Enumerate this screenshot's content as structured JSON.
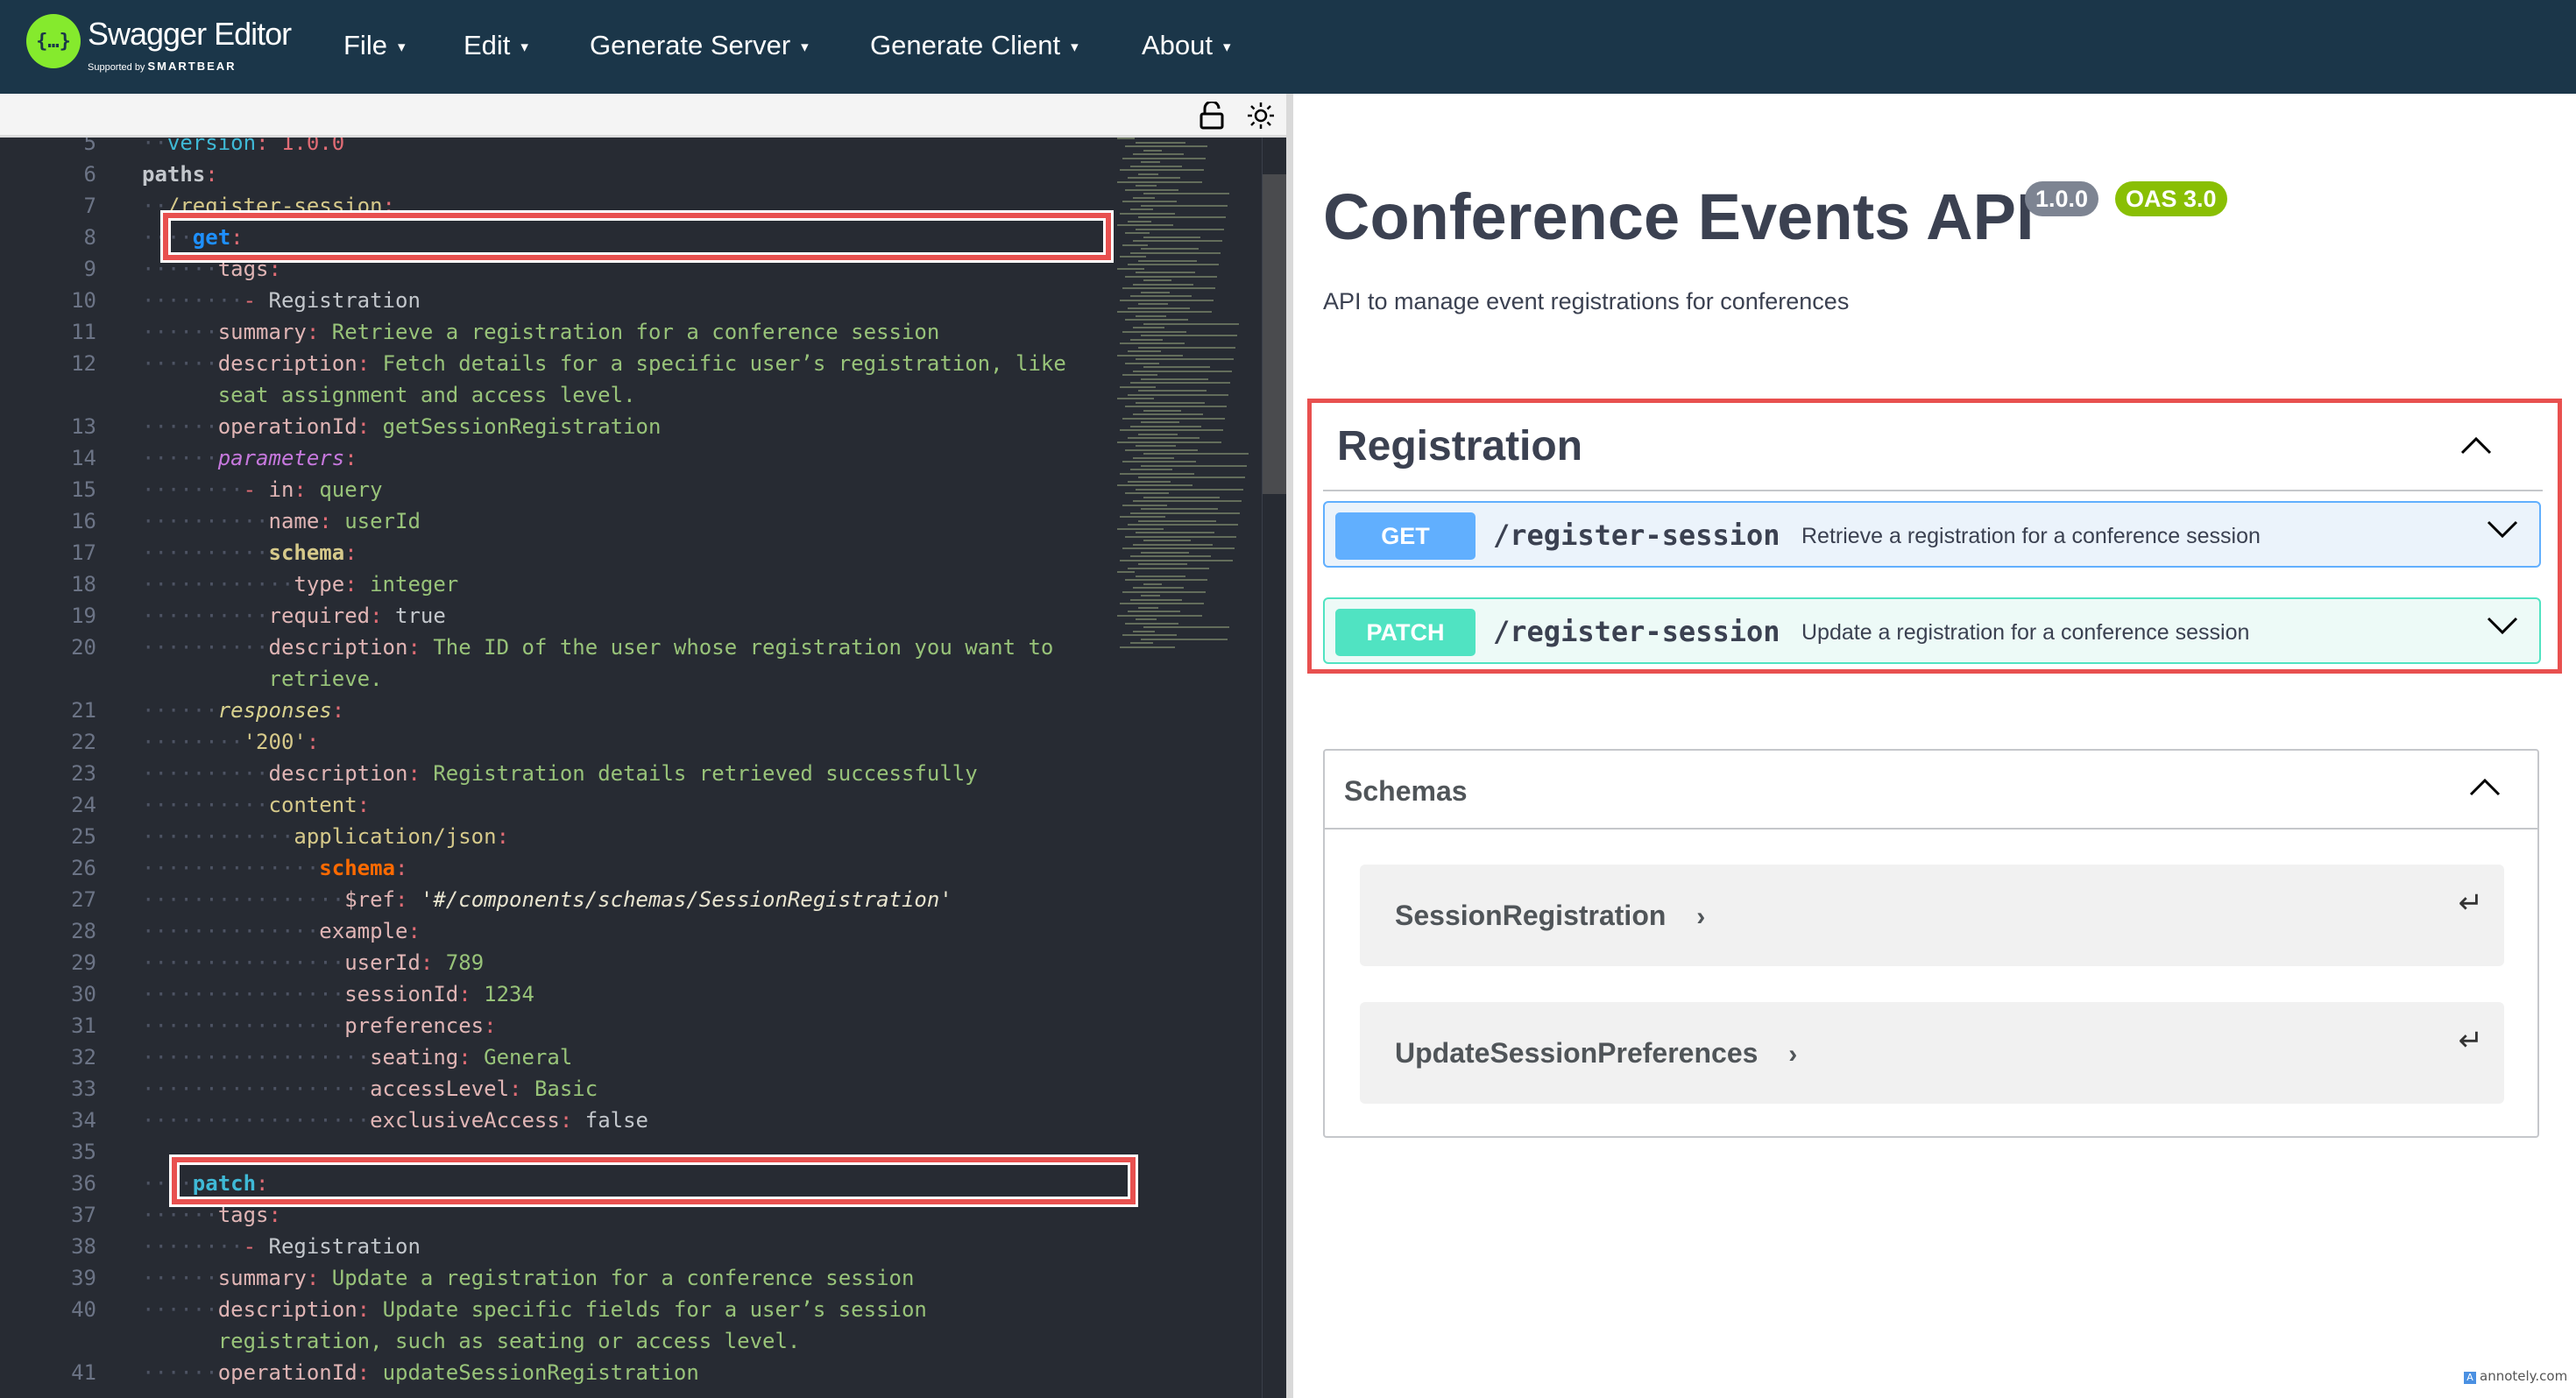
{
  "header": {
    "logo_glyph": "{…}",
    "app_name": "Swagger Editor",
    "supported_by": "Supported by",
    "brand": "SMARTBEAR",
    "nav": [
      {
        "label": "File"
      },
      {
        "label": "Edit"
      },
      {
        "label": "Generate Server"
      },
      {
        "label": "Generate Client"
      },
      {
        "label": "About"
      }
    ],
    "caret": "▾"
  },
  "toolbar": {
    "icons": [
      "unlock-icon",
      "theme-toggle-sun-icon"
    ]
  },
  "editor": {
    "lines": [
      {
        "n": "5",
        "indent": "··",
        "html": "<span class='cyan'>version</span><span class='p'>:</span> <span class='p'>1.0.0</span>"
      },
      {
        "n": "6",
        "indent": "",
        "html": "<span class='k2'>paths</span><span class='p'>:</span>"
      },
      {
        "n": "7",
        "indent": "··",
        "html": "<span class='y'>/register-session</span><span class='p'>:</span>"
      },
      {
        "n": "8",
        "indent": "····",
        "html": "<span class='blue'>get</span><span class='p'>:</span>"
      },
      {
        "n": "9",
        "indent": "······",
        "html": "<span class='k'>tags</span><span class='p'>:</span>"
      },
      {
        "n": "10",
        "indent": "········",
        "html": "<span class='p'>-</span> <span class='v'>Registration</span>"
      },
      {
        "n": "11",
        "indent": "······",
        "html": "<span class='k'>summary</span><span class='p'>:</span> <span class='s'>Retrieve a registration for a conference session</span>"
      },
      {
        "n": "12",
        "indent": "······",
        "html": "<span class='k'>description</span><span class='p'>:</span> <span class='s'>Fetch details for a specific user’s registration, like</span>"
      },
      {
        "n": "",
        "indent": "      ",
        "html": "<span class='s'>seat assignment and access level.</span>"
      },
      {
        "n": "13",
        "indent": "······",
        "html": "<span class='k'>operationId</span><span class='p'>:</span> <span class='s'>getSessionRegistration</span>"
      },
      {
        "n": "14",
        "indent": "······",
        "html": "<span class='purple'>parameters</span><span class='p'>:</span>"
      },
      {
        "n": "15",
        "indent": "········",
        "html": "<span class='p'>-</span> <span class='k'>in</span><span class='p'>:</span> <span class='s'>query</span>"
      },
      {
        "n": "16",
        "indent": "··········",
        "html": "<span class='k'>name</span><span class='p'>:</span> <span class='s'>userId</span>"
      },
      {
        "n": "17",
        "indent": "··········",
        "html": "<span class='y' style='font-weight:bold'>schema</span><span class='p'>:</span>"
      },
      {
        "n": "18",
        "indent": "············",
        "html": "<span class='k'>type</span><span class='p'>:</span> <span class='s'>integer</span>"
      },
      {
        "n": "19",
        "indent": "··········",
        "html": "<span class='k'>required</span><span class='p'>:</span> <span class='v'>true</span>"
      },
      {
        "n": "20",
        "indent": "··········",
        "html": "<span class='k'>description</span><span class='p'>:</span> <span class='s'>The ID of the user whose registration you want to</span>"
      },
      {
        "n": "",
        "indent": "          ",
        "html": "<span class='s'>retrieve.</span>"
      },
      {
        "n": "21",
        "indent": "······",
        "html": "<span class='ital'>responses</span><span class='p'>:</span>"
      },
      {
        "n": "22",
        "indent": "········",
        "html": "<span class='y'>'200'</span><span class='p'>:</span>"
      },
      {
        "n": "23",
        "indent": "··········",
        "html": "<span class='k'>description</span><span class='p'>:</span> <span class='s'>Registration details retrieved successfully</span>"
      },
      {
        "n": "24",
        "indent": "··········",
        "html": "<span class='y'>content</span><span class='p'>:</span>"
      },
      {
        "n": "25",
        "indent": "············",
        "html": "<span class='y'>application/json</span><span class='p'>:</span>"
      },
      {
        "n": "26",
        "indent": "··············",
        "html": "<span class='orange'>schema</span><span class='p'>:</span>"
      },
      {
        "n": "27",
        "indent": "················",
        "html": "<span class='k'>$ref</span><span class='p'>:</span> <span class='ref'>'#/components/schemas/SessionRegistration'</span>"
      },
      {
        "n": "28",
        "indent": "··············",
        "html": "<span class='k'>example</span><span class='p'>:</span>"
      },
      {
        "n": "29",
        "indent": "················",
        "html": "<span class='k'>userId</span><span class='p'>:</span> <span class='s'>789</span>"
      },
      {
        "n": "30",
        "indent": "················",
        "html": "<span class='k'>sessionId</span><span class='p'>:</span> <span class='s'>1234</span>"
      },
      {
        "n": "31",
        "indent": "················",
        "html": "<span class='k'>preferences</span><span class='p'>:</span>"
      },
      {
        "n": "32",
        "indent": "··················",
        "html": "<span class='k'>seating</span><span class='p'>:</span> <span class='s'>General</span>"
      },
      {
        "n": "33",
        "indent": "··················",
        "html": "<span class='k'>accessLevel</span><span class='p'>:</span> <span class='s'>Basic</span>"
      },
      {
        "n": "34",
        "indent": "··················",
        "html": "<span class='k'>exclusiveAccess</span><span class='p'>:</span> <span class='v'>false</span>"
      },
      {
        "n": "35",
        "indent": "",
        "html": ""
      },
      {
        "n": "36",
        "indent": "····",
        "html": "<span class='cyan' style='font-weight:bold'>patch</span><span class='p'>:</span>"
      },
      {
        "n": "37",
        "indent": "······",
        "html": "<span class='k'>tags</span><span class='p'>:</span>"
      },
      {
        "n": "38",
        "indent": "········",
        "html": "<span class='p'>-</span> <span class='v'>Registration</span>"
      },
      {
        "n": "39",
        "indent": "······",
        "html": "<span class='k'>summary</span><span class='p'>:</span> <span class='s'>Update a registration for a conference session</span>"
      },
      {
        "n": "40",
        "indent": "······",
        "html": "<span class='k'>description</span><span class='p'>:</span> <span class='s'>Update specific fields for a user’s session</span>"
      },
      {
        "n": "",
        "indent": "      ",
        "html": "<span class='s'>registration, such as seating or access level.</span>"
      },
      {
        "n": "41",
        "indent": "······",
        "html": "<span class='k'>operationId</span><span class='p'>:</span> <span class='s'>updateSessionRegistration</span>"
      }
    ]
  },
  "info": {
    "title": "Conference Events API",
    "version_badge": "1.0.0",
    "oas_badge": "OAS 3.0",
    "description": "API to manage event registrations for conferences"
  },
  "tag": {
    "name": "Registration",
    "operations": [
      {
        "method": "GET",
        "path": "/register-session",
        "summary": "Retrieve a registration for a conference session",
        "color": "#61affe",
        "bg": "#ebf3fb"
      },
      {
        "method": "PATCH",
        "path": "/register-session",
        "summary": "Update a registration for a conference session",
        "color": "#50e3c2",
        "bg": "#edfaf7"
      }
    ]
  },
  "schemas": {
    "title": "Schemas",
    "items": [
      {
        "name": "SessionRegistration"
      },
      {
        "name": "UpdateSessionPreferences"
      }
    ]
  },
  "colors": {
    "header_bg": "#1b3649",
    "highlight_red": "#e8504f",
    "version_badge": "#7d8492",
    "oas_badge": "#89bf04"
  },
  "watermark": "annotely.com"
}
